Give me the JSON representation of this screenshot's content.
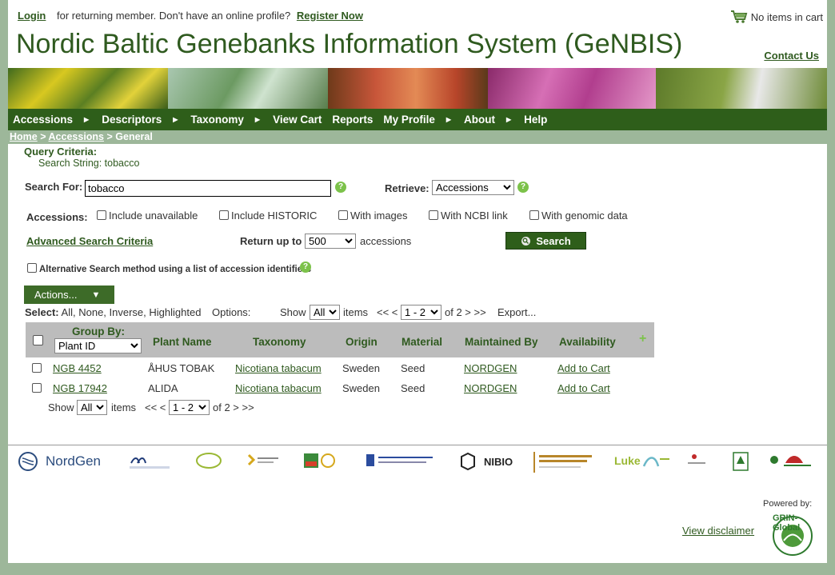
{
  "top": {
    "login": "Login",
    "returning_text": "for returning member. Don't have an online profile?",
    "register": "Register Now",
    "cart": "No items in cart",
    "title": "Nordic Baltic Genebanks Information System (GeNBIS)",
    "contact": "Contact Us"
  },
  "nav": {
    "items": [
      "Accessions",
      "Descriptors",
      "Taxonomy",
      "View Cart",
      "Reports",
      "My Profile",
      "About",
      "Help"
    ]
  },
  "breadcrumb": {
    "home": "Home",
    "sep1": " > ",
    "accessions": "Accessions",
    "sep2": " > ",
    "current": "General"
  },
  "query": {
    "label": "Query Criteria:",
    "search_string": "Search String: tobacco"
  },
  "search": {
    "label": "Search For:",
    "value": "tobacco",
    "retrieve_label": "Retrieve:",
    "retrieve_value": "Accessions",
    "accessions_label": "Accessions:",
    "options": [
      "Include unavailable",
      "Include HISTORIC",
      "With images",
      "With NCBI link",
      "With genomic data"
    ],
    "advanced": "Advanced Search Criteria",
    "return_label": "Return up to",
    "return_value": "500",
    "return_suffix": "accessions",
    "search_button": "Search",
    "alt_method": "Alternative Search method using a list of accession identifiers"
  },
  "results": {
    "actions_label": "Actions...",
    "select_label": "Select:",
    "select_options": "All, None, Inverse, Highlighted",
    "options_label": "Options:",
    "show_label": "Show",
    "show_value": "All",
    "items_label": "items",
    "prev": "<< <",
    "page_value": "1 - 2",
    "of_text": "of 2 > >>",
    "export": "Export...",
    "group_by_label": "Group By:",
    "group_by_value": "Plant ID",
    "columns": [
      "Plant Name",
      "Taxonomy",
      "Origin",
      "Material",
      "Maintained By",
      "Availability"
    ],
    "rows": [
      {
        "id": "NGB 4452",
        "name": "ÅHUS TOBAK",
        "taxonomy": "Nicotiana tabacum",
        "origin": "Sweden",
        "material": "Seed",
        "maintained": "NORDGEN",
        "availability": "Add to Cart"
      },
      {
        "id": "NGB 17942",
        "name": "ALIDA",
        "taxonomy": "Nicotiana tabacum",
        "origin": "Sweden",
        "material": "Seed",
        "maintained": "NORDGEN",
        "availability": "Add to Cart"
      }
    ]
  },
  "footer": {
    "nordgen": "NordGen",
    "nibio": "NIBIO",
    "luke": "Luke",
    "powered_by": "Powered by:",
    "disclaimer": "View disclaimer",
    "grin": "GRIN-Global"
  },
  "colors": {
    "brand": "#2e5e1a",
    "frame": "#9db79a",
    "link": "#2f5a1f"
  }
}
